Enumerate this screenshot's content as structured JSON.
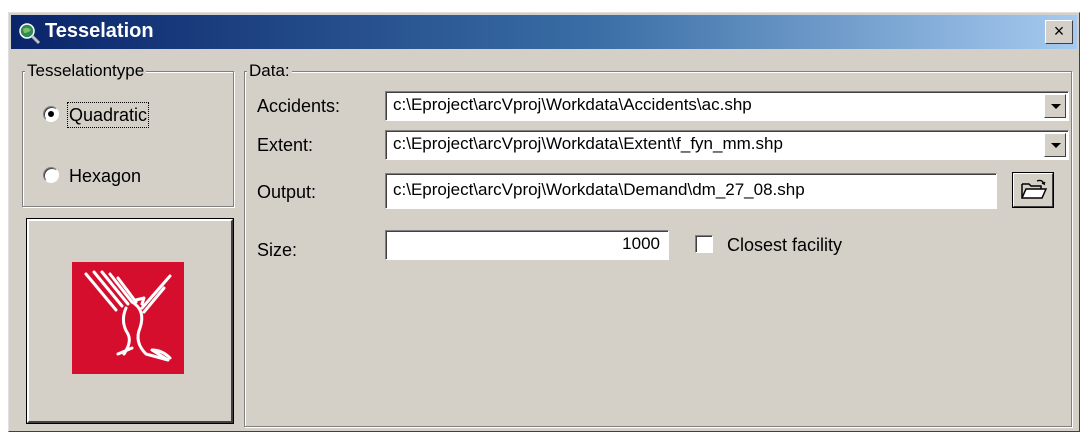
{
  "window": {
    "title": "Tesselation",
    "close_label": "×"
  },
  "tesselation_type": {
    "legend": "Tesselationtype",
    "options": [
      {
        "label": "Quadratic",
        "selected": true
      },
      {
        "label": "Hexagon",
        "selected": false
      }
    ]
  },
  "data": {
    "legend": "Data:",
    "accidents": {
      "label": "Accidents:",
      "value": "c:\\Eproject\\arcVproj\\Workdata\\Accidents\\ac.shp"
    },
    "extent": {
      "label": "Extent:",
      "value": "c:\\Eproject\\arcVproj\\Workdata\\Extent\\f_fyn_mm.shp"
    },
    "output": {
      "label": "Output:",
      "value": "c:\\Eproject\\arcVproj\\Workdata\\Demand\\dm_27_08.shp"
    },
    "size": {
      "label": "Size:",
      "value": "1000"
    },
    "closest_facility": {
      "label": "Closest facility",
      "checked": false
    }
  },
  "icons": {
    "app": "globe-magnifier-icon",
    "logo": "eagle-logo",
    "browse": "open-folder-icon",
    "combo": "chevron-down-icon"
  },
  "colors": {
    "title_start": "#0a246a",
    "title_end": "#a6caf0",
    "dialog_bg": "#d4d0c8",
    "logo_bg": "#d60e2e"
  }
}
